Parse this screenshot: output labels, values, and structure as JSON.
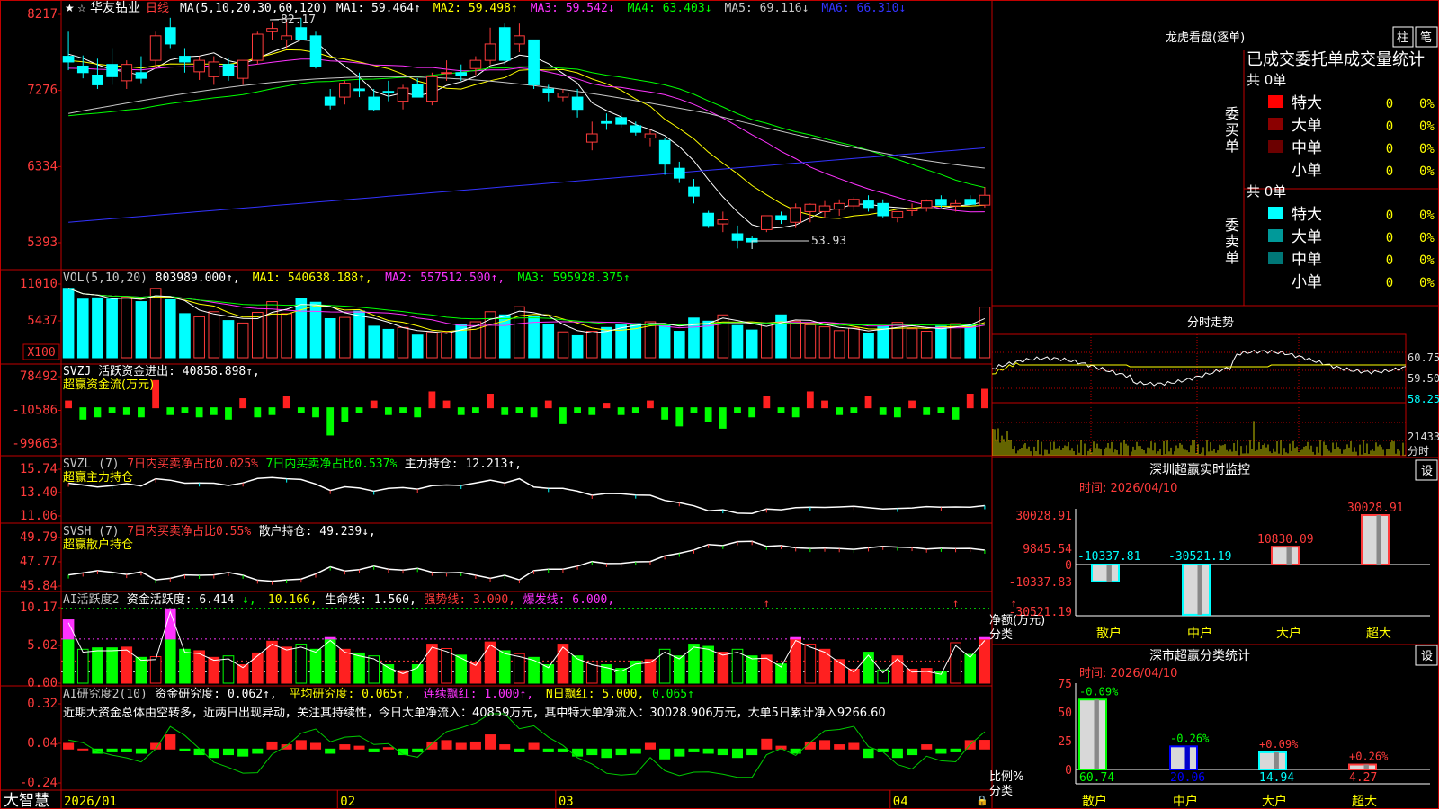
{
  "app": {
    "brand": "大智慧",
    "stock_name": "华友钴业",
    "period": "日线",
    "star": "★",
    "mark": "☆"
  },
  "colors": {
    "up": "#ff3b3b",
    "down": "#00ffff",
    "ma1": "#ffffff",
    "ma2": "#ffff00",
    "ma3": "#ff33ff",
    "ma4": "#00ff00",
    "ma5": "#c8c8c8",
    "ma6": "#3333ff",
    "frame": "#c00000"
  },
  "x_axis": {
    "labels": [
      "2026/01",
      "02",
      "03",
      "04"
    ],
    "label_index": [
      0,
      19,
      34,
      57
    ],
    "n": 64
  },
  "main": {
    "legend_prefix": "MA(5,10,20,30,60,120)",
    "legend": [
      {
        "text": "MA1: 59.464↑",
        "color": "#ffffff"
      },
      {
        "text": "MA2: 59.498↑",
        "color": "#ffff00"
      },
      {
        "text": "MA3: 59.542↓",
        "color": "#ff33ff"
      },
      {
        "text": "MA4: 63.403↓",
        "color": "#00ff00"
      },
      {
        "text": "MA5: 69.116↓",
        "color": "#c8c8c8"
      },
      {
        "text": "MA6: 66.310↓",
        "color": "#3333ff"
      }
    ],
    "y_ticks": [
      "8217",
      "7276",
      "6334",
      "5393"
    ],
    "high_label": "82.17",
    "low_label": "53.93"
  },
  "vol": {
    "legend": [
      {
        "text": "VOL(5,10,20)",
        "color": "#c8c8c8"
      },
      {
        "text": "803989.000↑,",
        "color": "#ffffff"
      },
      {
        "text": "MA1: 540638.188↑,",
        "color": "#ffff00"
      },
      {
        "text": "MA2: 557512.500↑,",
        "color": "#ff33ff"
      },
      {
        "text": "MA3: 595928.375↑",
        "color": "#00ff00"
      }
    ],
    "y_ticks": [
      "11010",
      "5437",
      "X100"
    ]
  },
  "svzj": {
    "legend": [
      {
        "text": "SVZJ  活跃资金进出: 40858.898↑,",
        "color": "#ffffff"
      }
    ],
    "sub": "超赢资金流(万元)",
    "y_ticks": [
      "78492",
      "-10586",
      "-99663"
    ]
  },
  "svzl": {
    "legend": [
      {
        "text": "SVZL (7)",
        "color": "#c8c8c8"
      },
      {
        "text": "7日内买卖净占比0.025%",
        "color": "#ff3b3b"
      },
      {
        "text": "7日内买卖净占比0.537%",
        "color": "#00ff00"
      },
      {
        "text": "主力持仓: 12.213↑,",
        "color": "#ffffff"
      }
    ],
    "sub": "超赢主力持仓",
    "y_ticks": [
      "15.74",
      "13.40",
      "11.06"
    ]
  },
  "svsh": {
    "legend": [
      {
        "text": "SVSH (7)",
        "color": "#c8c8c8"
      },
      {
        "text": "7日内买卖净占比0.55%",
        "color": "#ff3b3b"
      },
      {
        "text": "散户持仓: 49.239↓,",
        "color": "#ffffff"
      }
    ],
    "sub": "超赢散户持仓",
    "y_ticks": [
      "49.79",
      "47.77",
      "45.84"
    ]
  },
  "ai1": {
    "legend": [
      {
        "text": "AI活跃度2",
        "color": "#c8c8c8"
      },
      {
        "text": "资金活跃度: 6.414",
        "color": "#ffffff"
      },
      {
        "text": "↓,",
        "color": "#00ff00"
      },
      {
        "text": "10.166,",
        "color": "#ffff00"
      },
      {
        "text": "生命线: 1.560,",
        "color": "#ffffff"
      },
      {
        "text": "强势线: 3.000,",
        "color": "#ff3b3b"
      },
      {
        "text": "爆发线: 6.000,",
        "color": "#ff33ff"
      }
    ],
    "y_ticks": [
      "10.17",
      "5.02",
      "0.00"
    ]
  },
  "ai2": {
    "legend": [
      {
        "text": "AI研究度2(10)",
        "color": "#c8c8c8"
      },
      {
        "text": "资金研究度: 0.062↑,",
        "color": "#ffffff"
      },
      {
        "text": "平均研究度: 0.065↑,",
        "color": "#ffff00"
      },
      {
        "text": "连续飘红: 1.000↑,",
        "color": "#ff33ff"
      },
      {
        "text": "N日飘红: 5.000,",
        "color": "#ffff00"
      },
      {
        "text": "0.065↑",
        "color": "#00ff00"
      }
    ],
    "comment": "近期大资金总体由空转多，近两日出现异动，关注其持续性，今日大单净流入：40859万元，其中特大单净流入：30028.906万元，大单5日累计净入9266.60",
    "y_ticks": [
      "0.32",
      "0.04",
      "-0.24"
    ]
  },
  "right": {
    "lhkp_title": "龙虎看盘(逐单)",
    "buttons": [
      "柱",
      "笔"
    ],
    "section_title": "已成交委托单成交量统计",
    "buy": {
      "label": "委买单",
      "total": "共 0单",
      "rows": [
        {
          "name": "特大",
          "color": "#ff0000",
          "count": "0",
          "pct": "0%"
        },
        {
          "name": "大单",
          "color": "#8b0000",
          "count": "0",
          "pct": "0%"
        },
        {
          "name": "中单",
          "color": "#6b0000",
          "count": "0",
          "pct": "0%"
        },
        {
          "name": "小单",
          "color": "",
          "count": "0",
          "pct": "0%"
        }
      ]
    },
    "sell": {
      "label": "委卖单",
      "total": "共 0单",
      "rows": [
        {
          "name": "特大",
          "color": "#00ffff",
          "count": "0",
          "pct": "0%"
        },
        {
          "name": "大单",
          "color": "#009999",
          "count": "0",
          "pct": "0%"
        },
        {
          "name": "中单",
          "color": "#007777",
          "count": "0",
          "pct": "0%"
        },
        {
          "name": "小单",
          "color": "",
          "count": "0",
          "pct": "0%"
        }
      ]
    },
    "intraday": {
      "title": "分时走势",
      "y_ticks": [
        "60.75",
        "59.50",
        "58.25"
      ],
      "vol_tick": "21433",
      "vol_label": "分时"
    },
    "sz_monitor": {
      "title": "深圳超赢实时监控",
      "settings_label": "设",
      "date_label": "时间: 2026/04/10",
      "y_ticks": [
        "30028.91",
        "9845.54",
        "0",
        "-10337.83",
        "-30521.19"
      ],
      "ylabel": "净额(万元)",
      "xlabel_side": "分类",
      "categories": [
        "散户",
        "中户",
        "大户",
        "超大"
      ],
      "values": [
        -10337.81,
        -30521.19,
        10830.09,
        30028.91
      ],
      "value_labels": [
        "-10337.81",
        "-30521.19",
        "10830.09",
        "30028.91"
      ]
    },
    "sz_class": {
      "title": "深市超赢分类统计",
      "settings_label": "设",
      "date_label": "时间: 2026/04/10",
      "y_ticks": [
        "75",
        "50",
        "25",
        "0"
      ],
      "ylabel": "比例%",
      "xlabel_side": "分类",
      "categories": [
        "散户",
        "中户",
        "大户",
        "超大"
      ],
      "values": [
        60.74,
        20.06,
        14.94,
        4.27
      ],
      "changes": [
        "-0.09%",
        "-0.26%",
        "+0.09%",
        "+0.26%"
      ],
      "value_labels": [
        "60.74",
        "20.06",
        "14.94",
        "4.27"
      ]
    }
  },
  "chart_data": [
    {
      "type": "candlestick",
      "title": "华友钴业 日线",
      "x": [
        "2026/01",
        "02",
        "03",
        "04"
      ],
      "ohlc": [
        [
          77.5,
          80.5,
          75.8,
          76.8
        ],
        [
          76.3,
          77.6,
          74.8,
          75.5
        ],
        [
          75.2,
          77.2,
          73.5,
          74.0
        ],
        [
          76.5,
          78.5,
          74.0,
          75.0
        ],
        [
          74.5,
          77.0,
          73.5,
          76.5
        ],
        [
          75.5,
          77.5,
          74.2,
          74.8
        ],
        [
          77.0,
          80.5,
          76.0,
          80.0
        ],
        [
          81.0,
          82.2,
          78.5,
          79.0
        ],
        [
          77.5,
          78.5,
          75.5,
          76.8
        ],
        [
          75.6,
          77.5,
          74.6,
          77.0
        ],
        [
          75.0,
          77.5,
          74.0,
          76.8
        ],
        [
          76.5,
          77.2,
          74.5,
          75.2
        ],
        [
          74.8,
          77.0,
          74.0,
          77.0
        ],
        [
          77.0,
          80.5,
          76.5,
          80.2
        ],
        [
          80.5,
          81.6,
          79.5,
          80.9
        ],
        [
          79.5,
          82.0,
          78.5,
          80.0
        ],
        [
          81.0,
          82.17,
          79.5,
          79.5
        ],
        [
          80.0,
          80.5,
          76.0,
          76.2
        ],
        [
          72.5,
          73.5,
          71.0,
          71.5
        ],
        [
          72.5,
          74.5,
          71.6,
          74.2
        ],
        [
          73.5,
          75.5,
          72.5,
          73.3
        ],
        [
          72.5,
          73.5,
          70.8,
          71.0
        ],
        [
          73.2,
          74.5,
          72.0,
          73.0
        ],
        [
          72.0,
          74.0,
          71.0,
          73.6
        ],
        [
          74.0,
          74.8,
          72.5,
          72.5
        ],
        [
          72.0,
          75.5,
          71.5,
          75.0
        ],
        [
          75.5,
          77.0,
          74.5,
          75.5
        ],
        [
          75.5,
          76.5,
          74.5,
          75.2
        ],
        [
          76.0,
          77.5,
          75.2,
          77.0
        ],
        [
          77.0,
          81.0,
          76.5,
          79.0
        ],
        [
          81.0,
          81.5,
          76.5,
          77.0
        ],
        [
          79.0,
          81.5,
          78.0,
          80.0
        ],
        [
          79.5,
          79.5,
          73.5,
          74.0
        ],
        [
          73.5,
          74.0,
          72.0,
          73.0
        ],
        [
          72.5,
          73.5,
          72.0,
          73.0
        ],
        [
          72.5,
          73.5,
          70.0,
          71.0
        ],
        [
          67.0,
          69.5,
          66.0,
          68.0
        ],
        [
          69.5,
          70.5,
          68.5,
          69.3
        ],
        [
          70.0,
          70.6,
          68.8,
          69.2
        ],
        [
          69.0,
          69.5,
          67.8,
          68.2
        ],
        [
          67.5,
          68.5,
          66.5,
          68.0
        ],
        [
          67.2,
          67.5,
          63.0,
          64.3
        ],
        [
          63.8,
          64.6,
          62.0,
          62.6
        ],
        [
          61.5,
          62.5,
          59.5,
          60.4
        ],
        [
          58.3,
          58.6,
          56.5,
          56.8
        ],
        [
          57.0,
          58.5,
          56.0,
          57.5
        ],
        [
          55.8,
          56.8,
          54.0,
          55.0
        ],
        [
          55.2,
          55.5,
          53.93,
          54.8
        ],
        [
          56.3,
          58.0,
          56.0,
          58.0
        ],
        [
          58.0,
          58.5,
          57.0,
          57.5
        ],
        [
          57.2,
          59.5,
          56.5,
          59.0
        ],
        [
          58.5,
          59.5,
          57.2,
          59.4
        ],
        [
          58.5,
          59.8,
          57.8,
          59.2
        ],
        [
          58.8,
          60.0,
          58.0,
          59.5
        ],
        [
          59.2,
          60.3,
          58.6,
          60.0
        ],
        [
          59.8,
          60.5,
          58.5,
          59.0
        ],
        [
          59.5,
          60.0,
          57.8,
          58.0
        ],
        [
          57.8,
          58.5,
          57.2,
          58.5
        ],
        [
          58.6,
          59.5,
          58.0,
          58.8
        ],
        [
          59.0,
          60.0,
          58.5,
          59.8
        ],
        [
          60.0,
          60.5,
          59.0,
          59.3
        ],
        [
          59.2,
          60.0,
          58.5,
          59.5
        ],
        [
          60.0,
          60.5,
          59.4,
          59.4
        ],
        [
          59.3,
          61.5,
          59.0,
          60.5
        ]
      ]
    },
    {
      "type": "bar",
      "title": "VOL(5,10,20)",
      "values": [
        11010,
        9300,
        9500,
        9300,
        9600,
        8900,
        11000,
        9200,
        7000,
        6500,
        7300,
        5900,
        5500,
        7200,
        8900,
        7000,
        9400,
        8800,
        6200,
        6400,
        7400,
        5000,
        4500,
        4800,
        3600,
        4000,
        4000,
        5300,
        5700,
        7300,
        6800,
        8100,
        6500,
        5300,
        4100,
        3500,
        4200,
        4800,
        5200,
        5400,
        5700,
        5200,
        4200,
        6300,
        5800,
        6800,
        5100,
        4400,
        5400,
        6800,
        5800,
        5200,
        4900,
        4300,
        4700,
        3800,
        5000,
        5600,
        4600,
        4200,
        5000,
        5400,
        5200,
        8040
      ]
    },
    {
      "type": "bar",
      "title": "超赢资金流(万元)",
      "values": [
        15000,
        -25000,
        -20000,
        -10000,
        -15000,
        -20000,
        60000,
        -15000,
        -10000,
        -20000,
        -15000,
        -25000,
        20000,
        -20000,
        -15000,
        25000,
        -10000,
        -20000,
        -60000,
        -30000,
        -10000,
        15000,
        -15000,
        -10000,
        -20000,
        35000,
        15000,
        -15000,
        -10000,
        30000,
        -15000,
        -10000,
        -20000,
        15000,
        -35000,
        -10000,
        -15000,
        10000,
        -15000,
        -10000,
        15000,
        -25000,
        -40000,
        -10000,
        -30000,
        -45000,
        -10000,
        -20000,
        25000,
        -10000,
        -20000,
        35000,
        15000,
        -15000,
        -10000,
        25000,
        -15000,
        -20000,
        15000,
        -15000,
        -10000,
        -25000,
        30000,
        40859
      ]
    },
    {
      "type": "bar",
      "title": "AI活跃度2",
      "values": [
        8.6,
        4.6,
        4.8,
        4.8,
        4.9,
        3.5,
        3.6,
        10.1,
        4.6,
        4.4,
        3.5,
        3.7,
        2.5,
        4.1,
        5.7,
        4.9,
        5.3,
        4.6,
        6.2,
        4.6,
        4.1,
        3.7,
        2.5,
        1.7,
        2.5,
        5.3,
        4.7,
        3.8,
        2.8,
        5.6,
        4.4,
        4.0,
        3.5,
        2.5,
        5.3,
        3.7,
        2.9,
        2.5,
        2.0,
        3.0,
        3.2,
        4.6,
        3.7,
        5.3,
        5.0,
        4.2,
        4.6,
        3.7,
        3.8,
        2.6,
        6.2,
        5.3,
        4.6,
        3.2,
        1.9,
        4.2,
        1.8,
        3.7,
        1.9,
        2.0,
        1.6,
        5.5,
        3.9,
        6.2
      ]
    },
    {
      "type": "bar",
      "title": "AI研究度2(10)",
      "values": [
        0.04,
        0.0,
        -0.03,
        -0.02,
        -0.02,
        -0.03,
        0.04,
        0.1,
        -0.01,
        -0.04,
        -0.06,
        -0.04,
        -0.05,
        -0.03,
        0.05,
        0.03,
        0.06,
        0.04,
        -0.03,
        0.03,
        0.02,
        -0.02,
        0.01,
        -0.04,
        -0.02,
        0.05,
        0.06,
        0.04,
        0.05,
        0.1,
        0.03,
        -0.02,
        0.04,
        -0.02,
        -0.02,
        -0.05,
        -0.04,
        -0.06,
        -0.04,
        -0.03,
        0.04,
        -0.07,
        -0.05,
        -0.02,
        -0.03,
        -0.04,
        -0.06,
        -0.04,
        0.07,
        0.02,
        -0.03,
        0.05,
        0.06,
        0.03,
        0.04,
        -0.06,
        -0.02,
        -0.06,
        -0.04,
        0.03,
        -0.03,
        -0.02,
        0.06,
        0.062
      ]
    },
    {
      "type": "bar",
      "title": "深圳超赢实时监控",
      "categories": [
        "散户",
        "中户",
        "大户",
        "超大"
      ],
      "values": [
        -10337.81,
        -30521.19,
        10830.09,
        30028.91
      ],
      "ylabel": "净额(万元)"
    },
    {
      "type": "bar",
      "title": "深市超赢分类统计",
      "categories": [
        "散户",
        "中户",
        "大户",
        "超大"
      ],
      "values": [
        60.74,
        20.06,
        14.94,
        4.27
      ],
      "ylabel": "比例%",
      "ylim": [
        0,
        75
      ]
    }
  ]
}
